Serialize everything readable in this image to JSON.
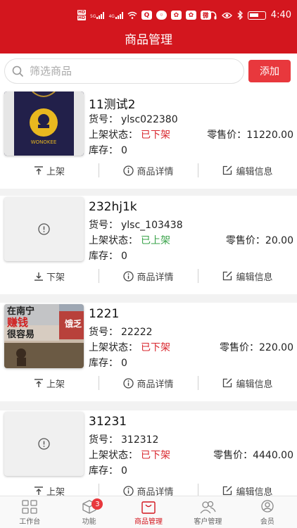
{
  "status_bar": {
    "time": "4:40",
    "hd_badges": [
      "HD",
      "HD"
    ],
    "signal_labels": [
      "5G",
      "4G"
    ],
    "app_icons": [
      "wifi-icon",
      "qq-icon",
      "wechat-icon",
      "baidu-icon",
      "baidu-icon",
      "weibo-icon",
      "headphone-icon",
      "eye-icon",
      "bluetooth-icon",
      "battery-icon"
    ]
  },
  "header": {
    "title": "商品管理"
  },
  "search": {
    "placeholder": "筛选商品",
    "add_label": "添加"
  },
  "labels": {
    "sku": "货号：",
    "status": "上架状态：",
    "price": "零售价：",
    "stock": "库存："
  },
  "products": [
    {
      "name": "11测试2",
      "sku": "ylsc022380",
      "status": "已下架",
      "price": "11220.00",
      "stock": "0",
      "image": "wonokee-bag",
      "action_toggle": "上架",
      "action_detail": "商品详情",
      "action_edit": "编辑信息"
    },
    {
      "name": "232hj1k",
      "sku": "ylsc_103438",
      "status": "已上架",
      "price": "20.00",
      "stock": "0",
      "image": "placeholder",
      "action_toggle": "下架",
      "action_detail": "商品详情",
      "action_edit": "编辑信息"
    },
    {
      "name": "1221",
      "sku": "22222",
      "status": "已下架",
      "price": "220.00",
      "stock": "0",
      "image": "poster",
      "action_toggle": "上架",
      "action_detail": "商品详情",
      "action_edit": "编辑信息"
    },
    {
      "name": "31231",
      "sku": "312312",
      "status": "已下架",
      "price": "4440.00",
      "stock": "0",
      "image": "placeholder",
      "action_toggle": "上架",
      "action_detail": "商品详情",
      "action_edit": "编辑信息"
    }
  ],
  "images": {
    "bag_logo_text": "WONOKEE",
    "poster_line1": "在南宁",
    "poster_line2": "赚钱",
    "poster_line3": "很容易",
    "poster_side": "饿乏"
  },
  "tabbar": {
    "items": [
      {
        "label": "工作台",
        "icon": "grid-icon"
      },
      {
        "label": "功能",
        "icon": "cube-icon",
        "badge": "3"
      },
      {
        "label": "商品管理",
        "icon": "bag-icon"
      },
      {
        "label": "客户管理",
        "icon": "users-icon"
      },
      {
        "label": "会员",
        "icon": "member-icon"
      }
    ]
  },
  "colors": {
    "brand": "#d3161e",
    "accent": "#e8383d",
    "off_status": "#d9272e",
    "on_status": "#3aa34a"
  }
}
